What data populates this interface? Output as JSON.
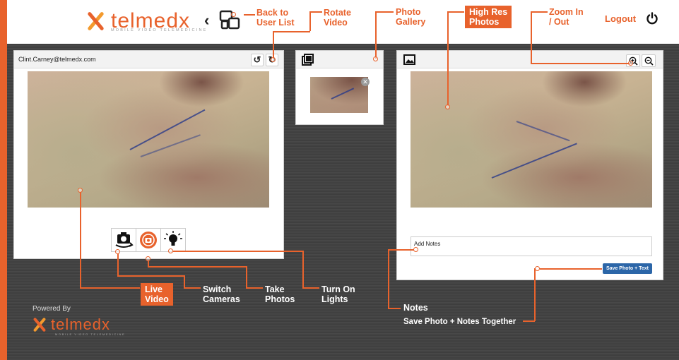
{
  "brand": {
    "name": "telmedx",
    "tagline": "MOBILE VIDEO TELEMEDICINE",
    "color": "#e8622c",
    "secondary": "#f39a2e"
  },
  "header": {
    "back_icon": "chevron-left-icon",
    "user_list_icon": "user-list-icon",
    "logout_label": "Logout",
    "power_icon": "power-icon"
  },
  "callouts": {
    "back_to_user_list": "Back to\nUser List",
    "rotate_video": "Rotate\nVideo",
    "photo_gallery": "Photo\nGallery",
    "high_res_photos": "High Res\nPhotos",
    "zoom_in_out": "Zoom In\n/ Out",
    "live_video": "Live\nVideo",
    "switch_cameras": "Switch\nCameras",
    "take_photos": "Take\nPhotos",
    "turn_on_lights": "Turn On\nLights",
    "notes": "Notes",
    "save_together": "Save Photo + Notes Together"
  },
  "video_panel": {
    "user_email": "Clint.Carney@telmedx.com",
    "rotate_left_icon": "rotate-left-icon",
    "rotate_right_icon": "rotate-right-icon",
    "buttons": [
      {
        "icon": "switch-camera-icon"
      },
      {
        "icon": "capture-photo-icon"
      },
      {
        "icon": "light-bulb-icon"
      }
    ]
  },
  "gallery_panel": {
    "icon": "gallery-icon",
    "close_icon": "close-icon",
    "close_glyph": "✕"
  },
  "highres_panel": {
    "icon": "image-icon",
    "zoom_in_icon": "zoom-in-icon",
    "zoom_out_icon": "zoom-out-icon",
    "notes_value": "Add Notes",
    "save_label": "Save Photo + Text",
    "save_color": "#2c66a8"
  },
  "footer": {
    "powered_by": "Powered By"
  }
}
